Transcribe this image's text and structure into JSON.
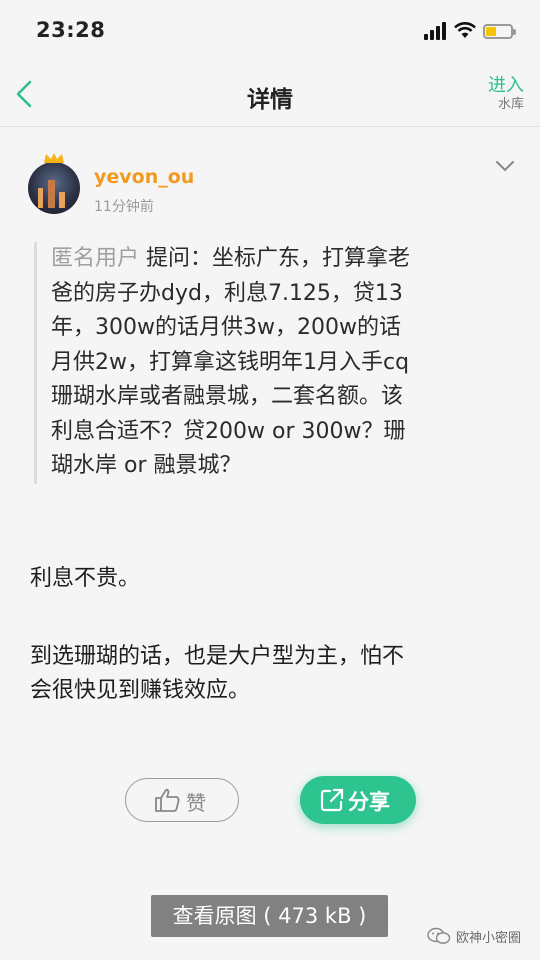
{
  "status_bar": {
    "time": "23:28"
  },
  "nav": {
    "title": "详情",
    "enter_label": "进入",
    "enter_sub": "水库"
  },
  "post": {
    "username": "yevon_ou",
    "time": "11分钟前"
  },
  "question": {
    "author": "匿名用户",
    "lines": [
      " 提问：坐标广东，打算拿老",
      "爸的房子办dyd，利息7.125，贷13",
      "年，300w的话月供3w，200w的话",
      "月供2w，打算拿这钱明年1月入手cq",
      "珊瑚水岸或者融景城，二套名额。该",
      "利息合适不？贷200w or 300w？珊",
      "瑚水岸 or 融景城？"
    ]
  },
  "answer": {
    "paragraph1": "利息不贵。",
    "paragraph2_line1": "到选珊瑚的话，也是大户型为主，怕不",
    "paragraph2_line2": "会很快见到赚钱效应。"
  },
  "actions": {
    "like_label": "赞",
    "share_label": "分享"
  },
  "view_original": "查看原图 ( 473 kB )",
  "watermark": "欧神小密圈",
  "colors": {
    "accent": "#2ec48f",
    "username": "#f39a1e"
  }
}
